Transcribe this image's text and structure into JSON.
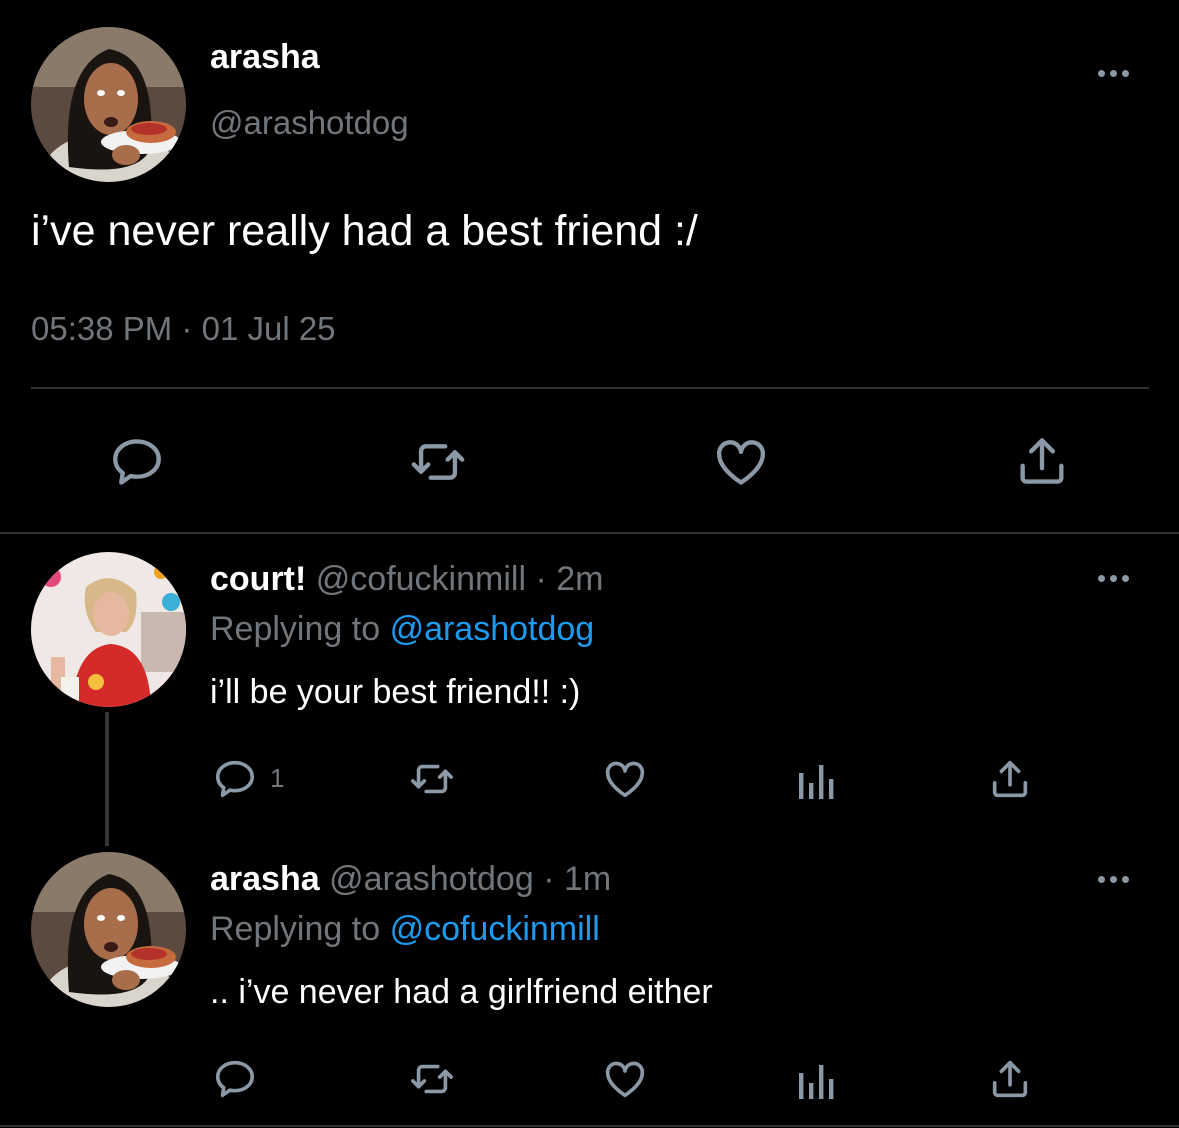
{
  "main_tweet": {
    "display_name": "arasha",
    "handle": "@arashotdog",
    "text": "i’ve never really had a best friend :/",
    "time": "05:38 PM",
    "separator": "·",
    "date": "01 Jul 25"
  },
  "replies": [
    {
      "display_name": "court!",
      "handle": "@cofuckinmill",
      "separator": "·",
      "age": "2m",
      "replying_prefix": "Replying to",
      "replying_to": "@arashotdog",
      "text": "i’ll be your best friend!! :)",
      "reply_count": "1"
    },
    {
      "display_name": "arasha",
      "handle": "@arashotdog",
      "separator": "·",
      "age": "1m",
      "replying_prefix": "Replying to",
      "replying_to": "@cofuckinmill",
      "text": ".. i’ve never had a girlfriend either",
      "reply_count": ""
    }
  ],
  "icons": [
    "more-icon",
    "reply-icon",
    "retweet-icon",
    "like-icon",
    "views-icon",
    "share-icon"
  ],
  "colors": {
    "background": "#000000",
    "text": "#e7e9ea",
    "muted": "#71767b",
    "link": "#1d9bf0",
    "divider": "#2f3336"
  }
}
